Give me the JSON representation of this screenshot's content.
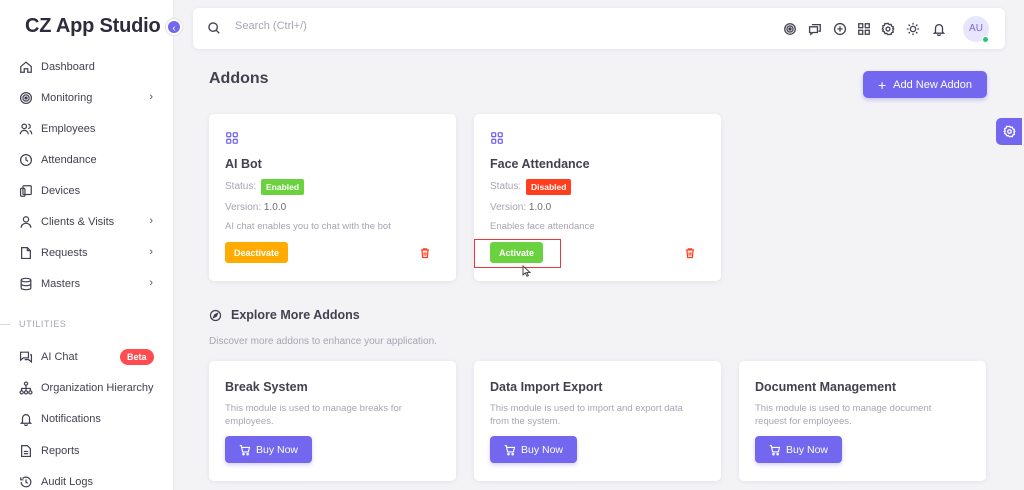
{
  "app": {
    "title": "CZ App Studio"
  },
  "sidebar": {
    "items": [
      {
        "label": "Dashboard",
        "icon": "home-icon"
      },
      {
        "label": "Monitoring",
        "icon": "target-icon",
        "has_submenu": true
      },
      {
        "label": "Employees",
        "icon": "users-icon"
      },
      {
        "label": "Attendance",
        "icon": "clock-icon"
      },
      {
        "label": "Devices",
        "icon": "devices-icon"
      },
      {
        "label": "Clients & Visits",
        "icon": "user-icon",
        "has_submenu": true
      },
      {
        "label": "Requests",
        "icon": "file-icon",
        "has_submenu": true
      },
      {
        "label": "Masters",
        "icon": "database-icon",
        "has_submenu": true
      }
    ],
    "section_label": "UTILITIES",
    "utilities": [
      {
        "label": "AI Chat",
        "icon": "chat-icon",
        "badge": "Beta"
      },
      {
        "label": "Organization Hierarchy",
        "icon": "hierarchy-icon"
      },
      {
        "label": "Notifications",
        "icon": "bell-icon"
      },
      {
        "label": "Reports",
        "icon": "report-icon"
      },
      {
        "label": "Audit Logs",
        "icon": "history-icon"
      }
    ]
  },
  "search": {
    "placeholder": "Search (Ctrl+/)"
  },
  "user": {
    "initials": "AU"
  },
  "page": {
    "title": "Addons",
    "add_button": "Add New Addon"
  },
  "addons": [
    {
      "name": "AI Bot",
      "status_label": "Status:",
      "status": "Enabled",
      "version_label": "Version:",
      "version": "1.0.0",
      "description": "AI chat enables you to chat with the bot",
      "action": "Deactivate"
    },
    {
      "name": "Face Attendance",
      "status_label": "Status:",
      "status": "Disabled",
      "version_label": "Version:",
      "version": "1.0.0",
      "description": "Enables face attendance",
      "action": "Activate"
    }
  ],
  "explore": {
    "title": "Explore More Addons",
    "subtitle": "Discover more addons to enhance your application."
  },
  "modules": [
    {
      "name": "Break System",
      "description": "This module is used to manage breaks for employees.",
      "button": "Buy Now"
    },
    {
      "name": "Data Import Export",
      "description": "This module is used to import and export data from the system.",
      "button": "Buy Now"
    },
    {
      "name": "Document Management",
      "description": "This module is used to manage document request for employees.",
      "button": "Buy Now"
    }
  ],
  "colors": {
    "primary": "#7367f0",
    "success": "#6bd23f",
    "danger": "#ff3e1d",
    "warning": "#ffab00"
  }
}
